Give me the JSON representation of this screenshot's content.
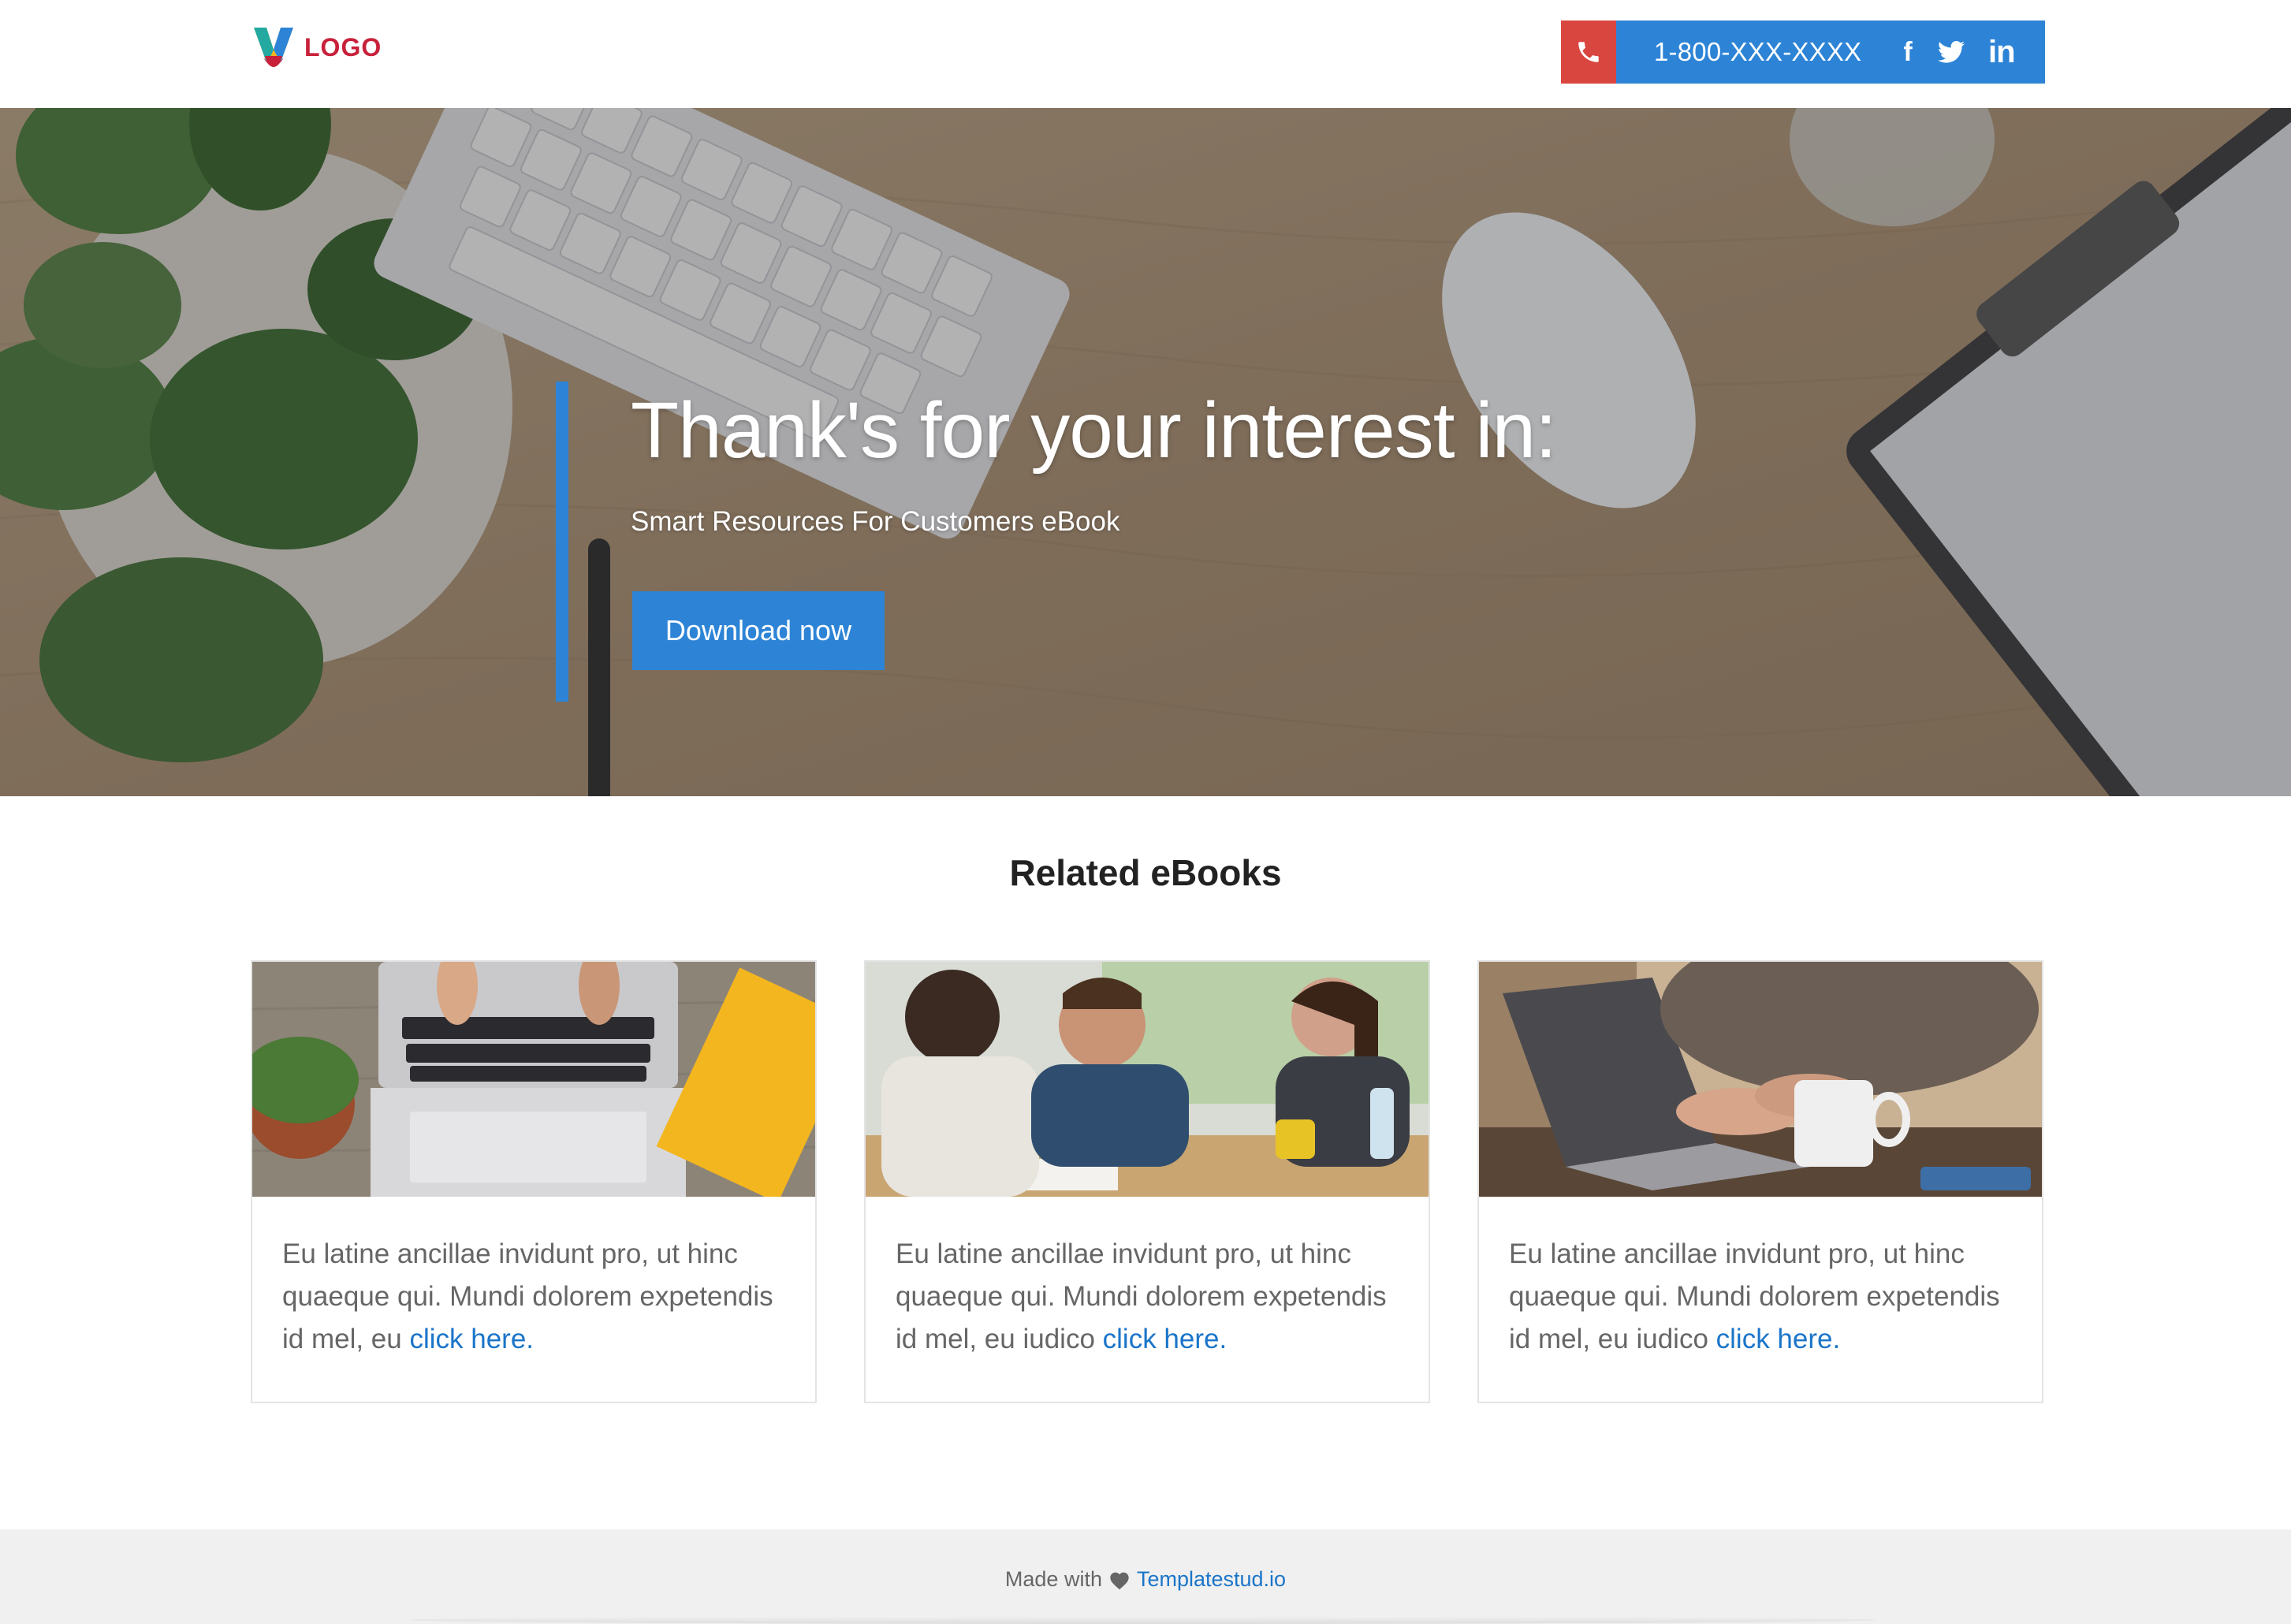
{
  "header": {
    "logo_text": "LOGO",
    "phone": "1-800-XXX-XXXX",
    "social": {
      "facebook": "f",
      "linkedin": "in"
    }
  },
  "hero": {
    "title": "Thank's for your interest in:",
    "subtitle": "Smart Resources For Customers eBook",
    "button_label": "Download now"
  },
  "related": {
    "heading": "Related eBooks",
    "cards": [
      {
        "text": "Eu latine ancillae invidunt pro, ut hinc quaeque qui. Mundi dolorem expetendis id mel, eu ",
        "link": "click here."
      },
      {
        "text": "Eu latine ancillae invidunt pro, ut hinc quaeque qui. Mundi dolorem expetendis id mel, eu iudico ",
        "link": "click here."
      },
      {
        "text": "Eu latine ancillae invidunt pro, ut hinc quaeque qui. Mundi dolorem expetendis id mel, eu iudico ",
        "link": "click here."
      }
    ]
  },
  "footer": {
    "made_with": "Made with",
    "brand": "Templatestud.io"
  },
  "colors": {
    "accent": "#2d84d6",
    "phone_box": "#d9463f",
    "logo": "#c8203a",
    "link": "#1b75c9"
  },
  "icons": [
    "phone-icon",
    "facebook-icon",
    "twitter-icon",
    "linkedin-icon",
    "heart-icon"
  ]
}
